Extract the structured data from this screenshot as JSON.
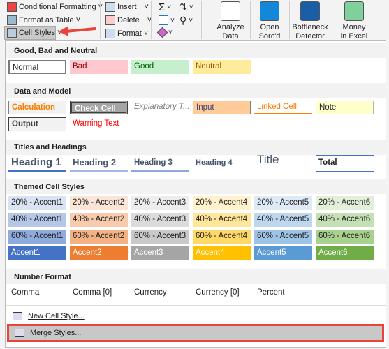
{
  "ribbon": {
    "conditional_formatting": "Conditional Formatting",
    "format_as_table": "Format as Table",
    "cell_styles": "Cell Styles",
    "insert": "Insert",
    "delete": "Delete",
    "format": "Format",
    "addins": [
      {
        "label1": "Analyze",
        "label2": "Data",
        "icon": "analyze-data-icon",
        "color": "#ffffff"
      },
      {
        "label1": "Open",
        "label2": "Sorc'd",
        "icon": "quote-icon",
        "color": "#1488d8"
      },
      {
        "label1": "Bottleneck",
        "label2": "Detector",
        "icon": "stopwatch-icon",
        "color": "#1a5ea8"
      },
      {
        "label1": "Money",
        "label2": "in Excel",
        "icon": "money-icon",
        "color": "#7fd09a"
      }
    ]
  },
  "sections": {
    "good_bad": "Good, Bad and Neutral",
    "data_model": "Data and Model",
    "titles": "Titles and Headings",
    "themed": "Themed Cell Styles",
    "number": "Number Format"
  },
  "good_bad": [
    "Normal",
    "Bad",
    "Good",
    "Neutral"
  ],
  "data_model_row1": [
    "Calculation",
    "Check Cell",
    "Explanatory T...",
    "Input",
    "Linked Cell",
    "Note"
  ],
  "data_model_row2": [
    "Output",
    "Warning Text"
  ],
  "headings": [
    "Heading 1",
    "Heading 2",
    "Heading 3",
    "Heading 4",
    "Title",
    "Total"
  ],
  "themed": {
    "p20": [
      "20% - Accent1",
      "20% - Accent2",
      "20% - Accent3",
      "20% - Accent4",
      "20% - Accent5",
      "20% - Accent6"
    ],
    "p40": [
      "40% - Accent1",
      "40% - Accent2",
      "40% - Accent3",
      "40% - Accent4",
      "40% - Accent5",
      "40% - Accent6"
    ],
    "p60": [
      "60% - Accent1",
      "60% - Accent2",
      "60% - Accent3",
      "60% - Accent4",
      "60% - Accent5",
      "60% - Accent6"
    ],
    "full": [
      "Accent1",
      "Accent2",
      "Accent3",
      "Accent4",
      "Accent5",
      "Accent6"
    ],
    "colors": {
      "p20": [
        "#dae3f3",
        "#fbe5d6",
        "#ededed",
        "#fff2cc",
        "#deebf7",
        "#e2f0d9"
      ],
      "p40": [
        "#b4c7e7",
        "#f8cbad",
        "#dbdbdb",
        "#ffe699",
        "#bdd7ee",
        "#c5e0b4"
      ],
      "p60": [
        "#8faadc",
        "#f4b183",
        "#c9c9c9",
        "#ffd966",
        "#9dc3e6",
        "#a9d18e"
      ],
      "full": [
        "#4472c4",
        "#ed7d31",
        "#a5a5a5",
        "#ffc000",
        "#5b9bd5",
        "#70ad47"
      ]
    }
  },
  "number_format": [
    "Comma",
    "Comma [0]",
    "Currency",
    "Currency [0]",
    "Percent"
  ],
  "footer": {
    "new_style": "New Cell Style...",
    "merge_styles": "Merge Styles..."
  }
}
